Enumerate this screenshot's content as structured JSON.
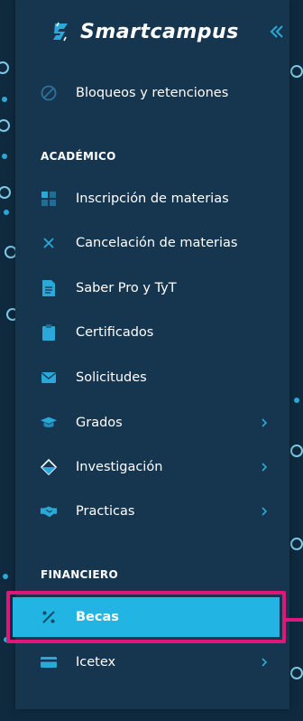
{
  "brand": {
    "name": "Smartcampus"
  },
  "colors": {
    "sidebar": "#163650",
    "accent": "#22b5e3",
    "highlight": "#e0177a",
    "icon": "#2aa9d8"
  },
  "menu": {
    "bloqueos": {
      "label": "Bloqueos y retenciones",
      "icon": "prohibited-icon"
    },
    "academico_title": "ACADÉMICO",
    "inscripcion": {
      "label": "Inscripción de materias",
      "icon": "grid-icon"
    },
    "cancelacion": {
      "label": "Cancelación de materias",
      "icon": "cross-icon"
    },
    "saber": {
      "label": "Saber Pro y TyT",
      "icon": "document-icon"
    },
    "certificados": {
      "label": "Certificados",
      "icon": "clipboard-icon"
    },
    "solicitudes": {
      "label": "Solicitudes",
      "icon": "mail-icon"
    },
    "grados": {
      "label": "Grados",
      "icon": "graduation-cap-icon"
    },
    "investigacion": {
      "label": "Investigación",
      "icon": "flask-icon"
    },
    "practicas": {
      "label": "Practicas",
      "icon": "handshake-icon"
    },
    "financiero_title": "FINANCIERO",
    "becas": {
      "label": "Becas",
      "icon": "percent-icon"
    },
    "icetex": {
      "label": "Icetex",
      "icon": "card-icon"
    }
  }
}
